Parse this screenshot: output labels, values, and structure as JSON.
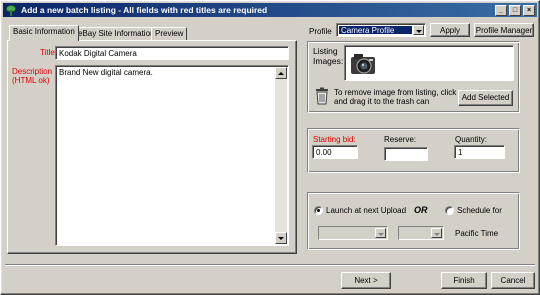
{
  "window": {
    "title": "Add a new batch listing - All fields with red titles are required",
    "minimize_glyph": "_",
    "maximize_glyph": "□",
    "close_glyph": "×"
  },
  "header": {
    "profile_label": "Profile",
    "profile_value": "Camera Profile",
    "apply_label": "Apply",
    "profile_manager_label": "Profile Manager"
  },
  "tabs": [
    {
      "label": "Basic Information",
      "active": true
    },
    {
      "label": "eBay Site Information",
      "active": false
    },
    {
      "label": "Preview",
      "active": false
    }
  ],
  "basic": {
    "title_label": "Title",
    "title_value": "Kodak Digital Camera",
    "description_label_1": "Description",
    "description_label_2": "(HTML ok)",
    "description_value": "Brand New digital camera."
  },
  "images": {
    "label_1": "Listing",
    "label_2": "Images:",
    "hint_1": "To remove image from listing, click",
    "hint_2": "and drag it to the trash can",
    "add_selected_label": "Add Selected"
  },
  "pricing": {
    "starting_bid_label": "Starting bid:",
    "starting_bid_value": "0.00",
    "reserve_label": "Reserve:",
    "reserve_value": "",
    "quantity_label": "Quantity:",
    "quantity_value": "1"
  },
  "schedule": {
    "launch_label": "Launch at next Upload",
    "or_label": "OR",
    "schedule_label": "Schedule for",
    "date_value": "",
    "time_value": "",
    "timezone_label": "Pacific Time",
    "launch_selected": true
  },
  "footer": {
    "next_label": "Next >",
    "finish_label": "Finish",
    "cancel_label": "Cancel"
  },
  "colors": {
    "required_label": "#e00000",
    "titlebar_start": "#0a246a",
    "titlebar_end": "#3a6ea5",
    "selected_combo": "#0a246a"
  },
  "icons": [
    "app-leaf-icon",
    "camera-thumbnail-icon",
    "trash-can-icon"
  ]
}
